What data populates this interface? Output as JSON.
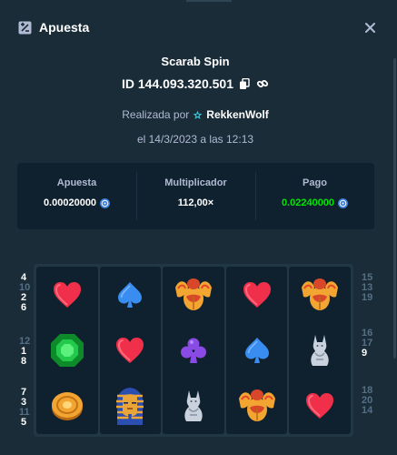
{
  "header": {
    "title": "Apuesta",
    "icon": "bet-ticket-icon",
    "close_icon": "close-icon"
  },
  "game": {
    "name": "Scarab Spin"
  },
  "bet": {
    "id": "ID 144.093.320.501",
    "placed_by_label": "Realizada por",
    "user": "RekkenWolf",
    "date": "el 14/3/2023 a las 12:13"
  },
  "stats": {
    "bet_label": "Apuesta",
    "bet_value": "0.00020000",
    "multiplier_label": "Multiplicador",
    "multiplier_value": "112,00×",
    "payout_label": "Pago",
    "payout_value": "0.02240000"
  },
  "paylines_left": [
    {
      "n": "4",
      "active": true
    },
    {
      "n": "10",
      "active": false
    },
    {
      "n": "2",
      "active": true
    },
    {
      "n": "6",
      "active": true
    },
    {
      "n": "12",
      "active": false
    },
    {
      "n": "1",
      "active": true
    },
    {
      "n": "8",
      "active": true
    },
    {
      "n": "7",
      "active": true
    },
    {
      "n": "3",
      "active": true
    },
    {
      "n": "11",
      "active": false
    },
    {
      "n": "5",
      "active": true
    }
  ],
  "paylines_right": [
    {
      "n": "15",
      "active": false
    },
    {
      "n": "13",
      "active": false
    },
    {
      "n": "19",
      "active": false
    },
    {
      "n": "16",
      "active": false
    },
    {
      "n": "17",
      "active": false
    },
    {
      "n": "9",
      "active": true
    },
    {
      "n": "18",
      "active": false
    },
    {
      "n": "20",
      "active": false
    },
    {
      "n": "14",
      "active": false
    }
  ],
  "reels": [
    [
      "heart",
      "emerald",
      "gold-coin"
    ],
    [
      "spade",
      "heart",
      "pharaoh"
    ],
    [
      "scarab",
      "club",
      "cat"
    ],
    [
      "heart",
      "spade",
      "scarab"
    ],
    [
      "scarab",
      "cat",
      "heart"
    ]
  ],
  "colors": {
    "bg": "#1a2c38",
    "panel": "#0f212e",
    "green": "#00e701",
    "muted": "#b1bad3"
  }
}
